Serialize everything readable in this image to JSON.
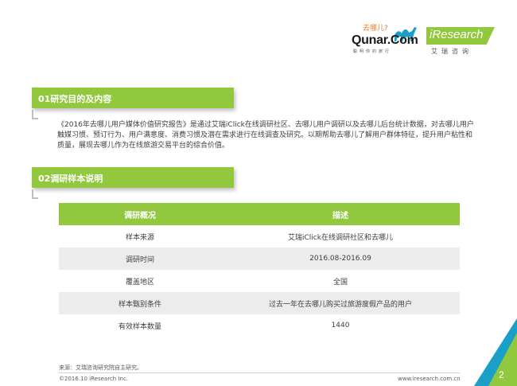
{
  "header": {
    "qunar_tagline": "去哪儿?",
    "qunar_logo": "Qunar.Com",
    "qunar_sub": "聪明你的旅行",
    "iresearch_logo": "iResearch",
    "iresearch_cn": "艾瑞咨询",
    "brand_color": "#92c83e"
  },
  "section1": {
    "title": "01研究目的及内容",
    "body": "《2016年去哪儿用户媒体价值研究报告》是通过艾瑞iClick在线调研社区、去哪儿用户调研以及去哪儿后台统计数据，对去哪儿用户触媒习惯、预订行为、用户满意度、消费习惯及潜在需求进行在线调查及研究。以期帮助去哪儿了解用户群体特征，提升用户粘性和质量，展现去哪儿作为在线旅游交易平台的综合价值。"
  },
  "section2": {
    "title": "02调研样本说明"
  },
  "table": {
    "headers": [
      "调研概况",
      "描述"
    ],
    "rows": [
      [
        "样本来源",
        "艾瑞iClick在线调研社区和去哪儿"
      ],
      [
        "调研时间",
        "2016.08-2016.09"
      ],
      [
        "覆盖地区",
        "全国"
      ],
      [
        "样本甄别条件",
        "过去一年在去哪儿购买过旅游度假产品的用户"
      ],
      [
        "有效样本数量",
        "1440"
      ]
    ]
  },
  "footer": {
    "source": "来源：艾瑞咨询研究院自主研究。",
    "copyright": "©2016.10 iResearch Inc.",
    "url": "www.iresearch.com.cn",
    "page_number": "2"
  }
}
